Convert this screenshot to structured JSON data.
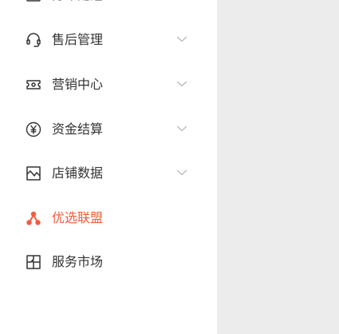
{
  "sidebar": {
    "items": [
      {
        "label": "分布配送",
        "icon": "truck-icon",
        "has_submenu": false,
        "active": false
      },
      {
        "label": "售后管理",
        "icon": "headset-icon",
        "has_submenu": true,
        "active": false
      },
      {
        "label": "营销中心",
        "icon": "ticket-icon",
        "has_submenu": true,
        "active": false
      },
      {
        "label": "资金结算",
        "icon": "yen-circle-icon",
        "has_submenu": true,
        "active": false
      },
      {
        "label": "店铺数据",
        "icon": "chart-icon",
        "has_submenu": true,
        "active": false
      },
      {
        "label": "优选联盟",
        "icon": "network-icon",
        "has_submenu": false,
        "active": true
      },
      {
        "label": "服务市场",
        "icon": "puzzle-icon",
        "has_submenu": false,
        "active": false
      }
    ]
  },
  "colors": {
    "active": "#f25c3d",
    "text": "#333333",
    "icon": "#333333",
    "chevron": "#bbbbbb",
    "background": "#ececec",
    "sidebar": "#ffffff"
  }
}
